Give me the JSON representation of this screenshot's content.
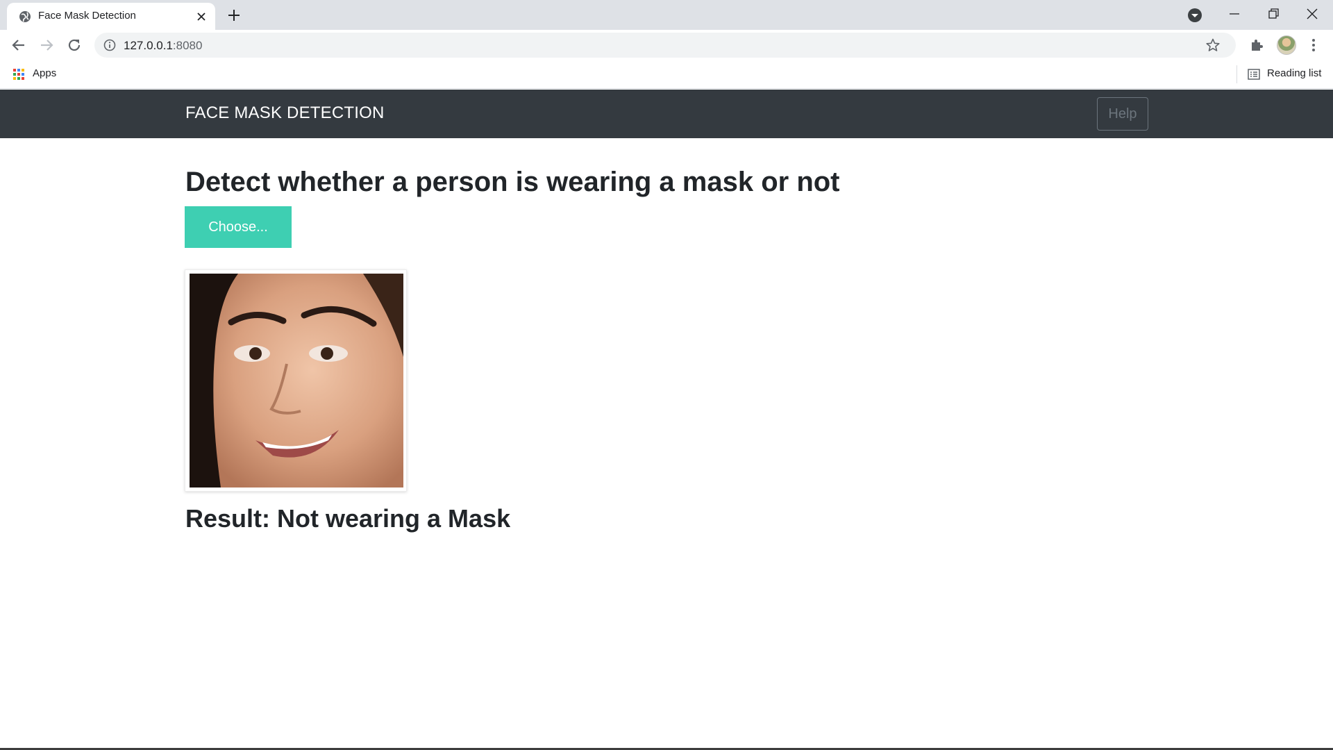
{
  "browser": {
    "tab": {
      "title": "Face Mask Detection"
    },
    "address": {
      "host": "127.0.0.1",
      "port": ":8080"
    },
    "bookmarks": {
      "apps_label": "Apps",
      "reading_list_label": "Reading list"
    }
  },
  "navbar": {
    "brand": "FACE MASK DETECTION",
    "help_label": "Help"
  },
  "main": {
    "heading": "Detect whether a person is wearing a mask or not",
    "choose_label": "Choose...",
    "result_text": "Result: Not wearing a Mask"
  },
  "colors": {
    "navbar_bg": "#343a40",
    "choose_button_bg": "#3ecfb2",
    "text_dark": "#212529",
    "help_border": "#6c757d"
  },
  "icons": [
    "globe-icon",
    "close-icon",
    "plus-icon",
    "tab-search-icon",
    "minimize-icon",
    "maximize-icon",
    "window-close-icon",
    "back-arrow-icon",
    "forward-arrow-icon",
    "reload-icon",
    "info-icon",
    "star-icon",
    "puzzle-icon",
    "kebab-menu-icon",
    "apps-grid-icon",
    "reading-list-icon"
  ]
}
